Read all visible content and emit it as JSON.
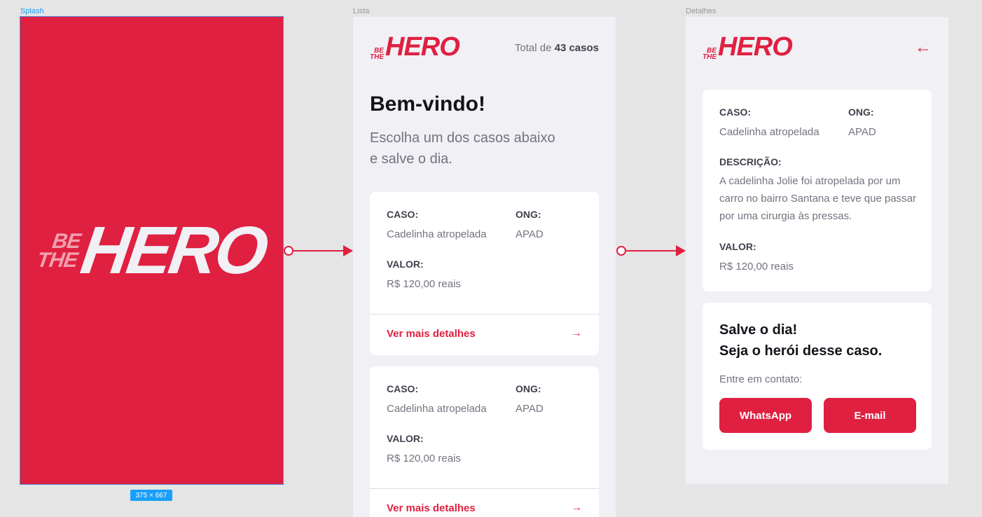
{
  "frames": {
    "splash_label": "Splash",
    "lista_label": "Lista",
    "detalhes_label": "Detalhes",
    "size_badge": "375 × 667"
  },
  "logo": {
    "line1": "BE",
    "line2": "THE",
    "line3": "HERO"
  },
  "colors": {
    "brand": "#e02041",
    "background": "#f0f0f5",
    "canvas": "#e5e5e5",
    "card": "#ffffff",
    "selection": "#18a0fb"
  },
  "lista": {
    "total_prefix": "Total de",
    "total_value": "43 casos",
    "title": "Bem-vindo!",
    "subtitle_line1": "Escolha um dos casos abaixo",
    "subtitle_line2": "e salve o dia.",
    "incidents": [
      {
        "caso_label": "CASO:",
        "caso": "Cadelinha atropelada",
        "ong_label": "ONG:",
        "ong": "APAD",
        "valor_label": "VALOR:",
        "valor": "R$ 120,00 reais",
        "details": "Ver mais detalhes",
        "arrow_icon": "arrow-right-icon"
      },
      {
        "caso_label": "CASO:",
        "caso": "Cadelinha atropelada",
        "ong_label": "ONG:",
        "ong": "APAD",
        "valor_label": "VALOR:",
        "valor": "R$ 120,00 reais",
        "details": "Ver mais detalhes",
        "arrow_icon": "arrow-right-icon"
      }
    ]
  },
  "detalhes": {
    "back_icon": "arrow-left-icon",
    "caso_label": "CASO:",
    "caso": "Cadelinha atropelada",
    "ong_label": "ONG:",
    "ong": "APAD",
    "descricao_label": "DESCRIÇÃO:",
    "descricao": "A cadelinha Jolie foi atropelada por um carro no bairro Santana e teve que passar por uma cirurgia às pressas.",
    "valor_label": "VALOR:",
    "valor": "R$ 120,00 reais",
    "hero_line1": "Salve o dia!",
    "hero_line2": "Seja o herói desse caso.",
    "contact_label": "Entre em contato:",
    "whatsapp_button": "WhatsApp",
    "email_button": "E-mail"
  }
}
